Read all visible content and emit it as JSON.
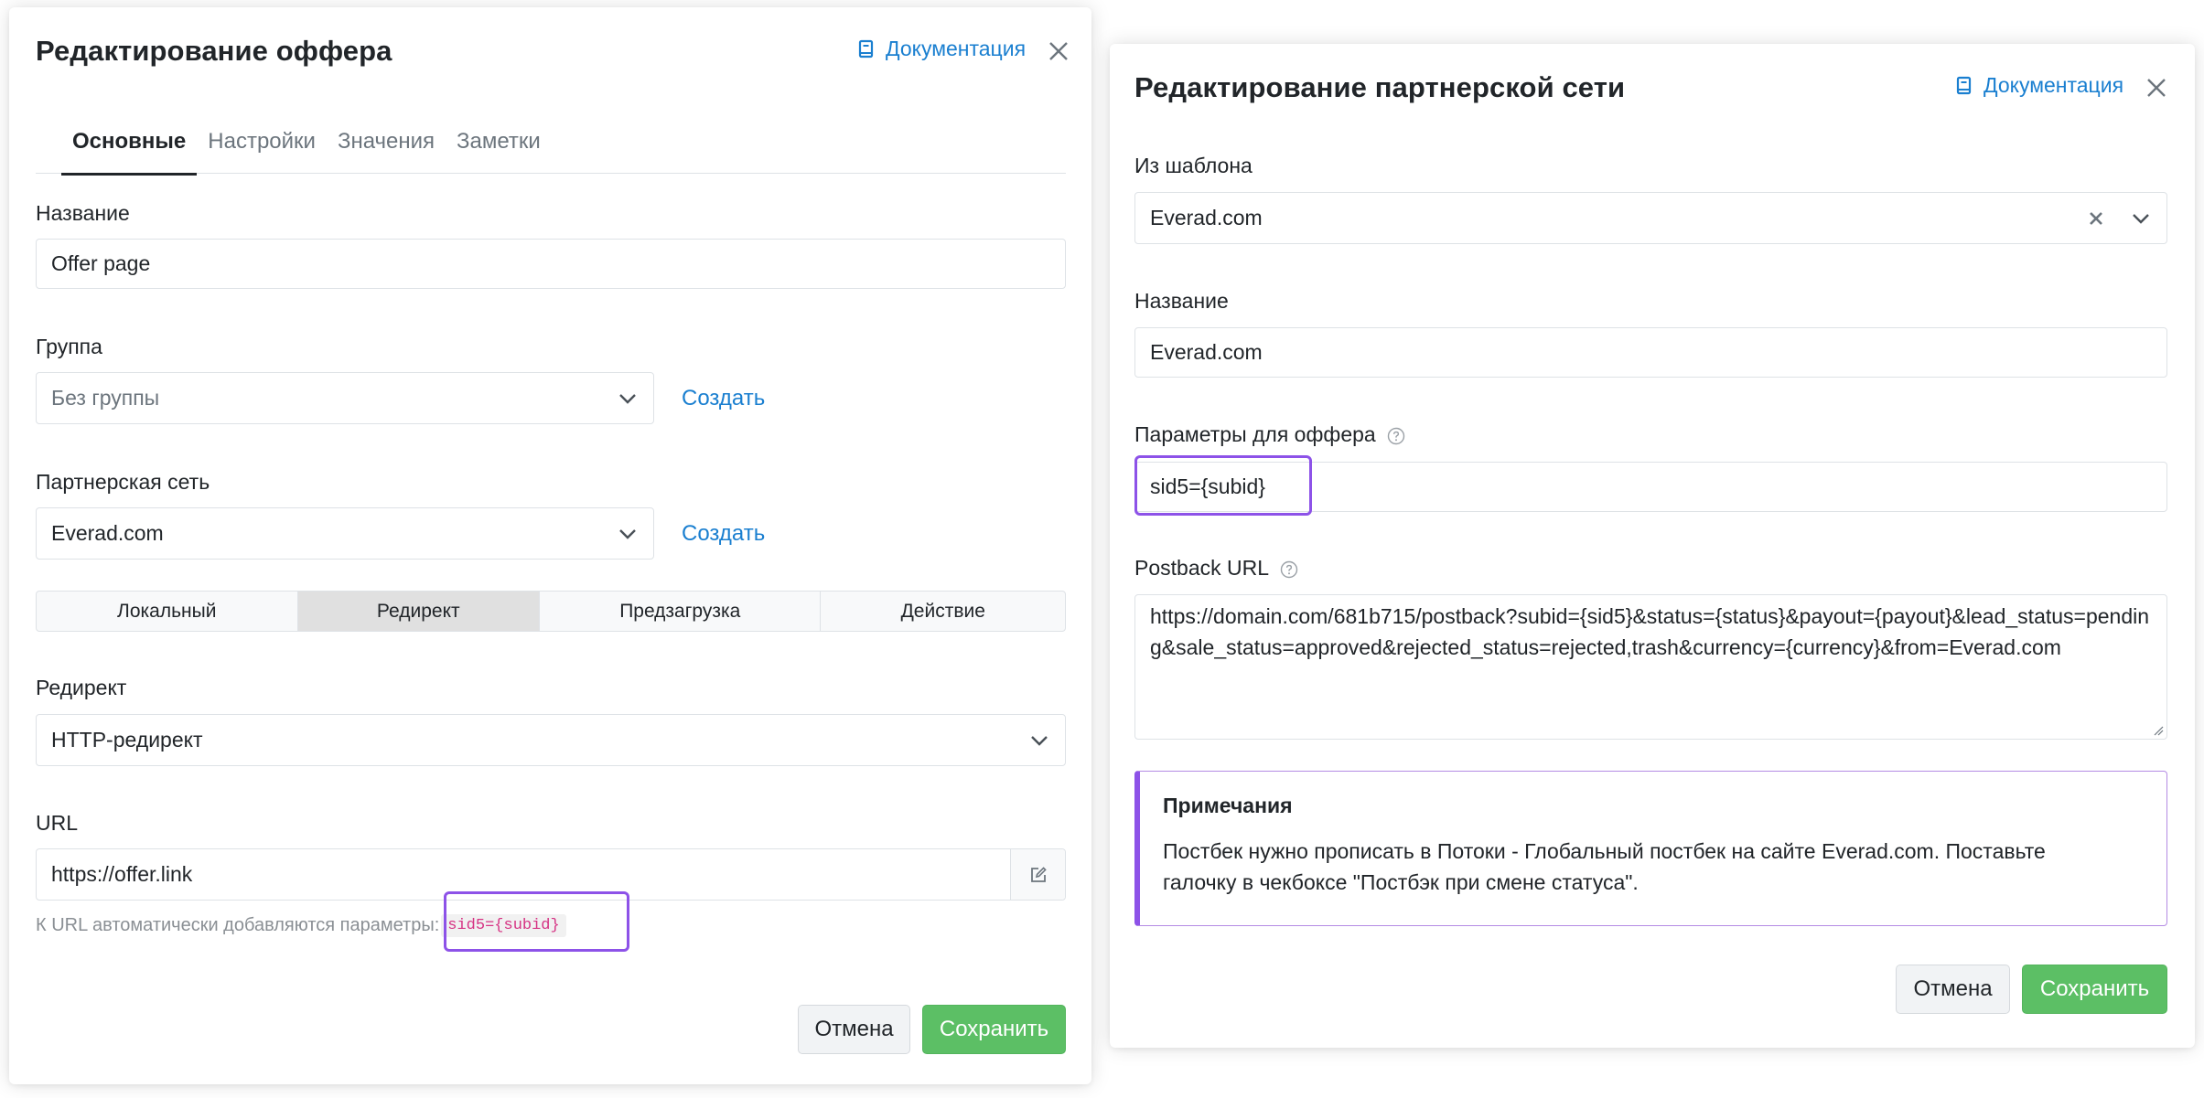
{
  "offer_modal": {
    "title": "Редактирование оффера",
    "doc_link": "Документация",
    "tabs": [
      "Основные",
      "Настройки",
      "Значения",
      "Заметки"
    ],
    "name_label": "Название",
    "name_value": "Offer page",
    "group_label": "Группа",
    "group_value": "Без группы",
    "group_create": "Создать",
    "network_label": "Партнерская сеть",
    "network_value": "Everad.com",
    "network_create": "Создать",
    "modes": [
      "Локальный",
      "Редирект",
      "Предзагрузка",
      "Действие"
    ],
    "active_mode": "Редирект",
    "redirect_label": "Редирект",
    "redirect_value": "HTTP-редирект",
    "url_label": "URL",
    "url_value": "https://offer.link",
    "url_hint": "К URL автоматически добавляются параметры:",
    "url_hint_code": "sid5={subid}",
    "cancel": "Отмена",
    "save": "Сохранить"
  },
  "network_modal": {
    "title": "Редактирование партнерской сети",
    "doc_link": "Документация",
    "template_label": "Из шаблона",
    "template_value": "Everad.com",
    "name_label": "Название",
    "name_value": "Everad.com",
    "offer_params_label": "Параметры для оффера",
    "offer_params_value": "sid5={subid}",
    "postback_label": "Postback URL",
    "postback_value": "https://domain.com/681b715/postback?subid={sid5}&status={status}&payout={payout}&lead_status=pending&sale_status=approved&rejected_status=rejected,trash&currency={currency}&from=Everad.com",
    "notes_title": "Примечания",
    "notes_text": "Постбек нужно прописать в Потоки - Глобальный постбек на сайте Everad.com. Поставьте галочку в чекбоксе \"Постбэк при смене статуса\".",
    "cancel": "Отмена",
    "save": "Сохранить"
  },
  "colors": {
    "link": "#1a7fd0",
    "save": "#5cbf65",
    "highlight": "#8d52e8",
    "code": "#d63384"
  },
  "icons": [
    "book-icon",
    "close-icon",
    "chevron-down-icon",
    "edit-icon",
    "help-icon",
    "clear-icon",
    "resize-grip-icon"
  ]
}
